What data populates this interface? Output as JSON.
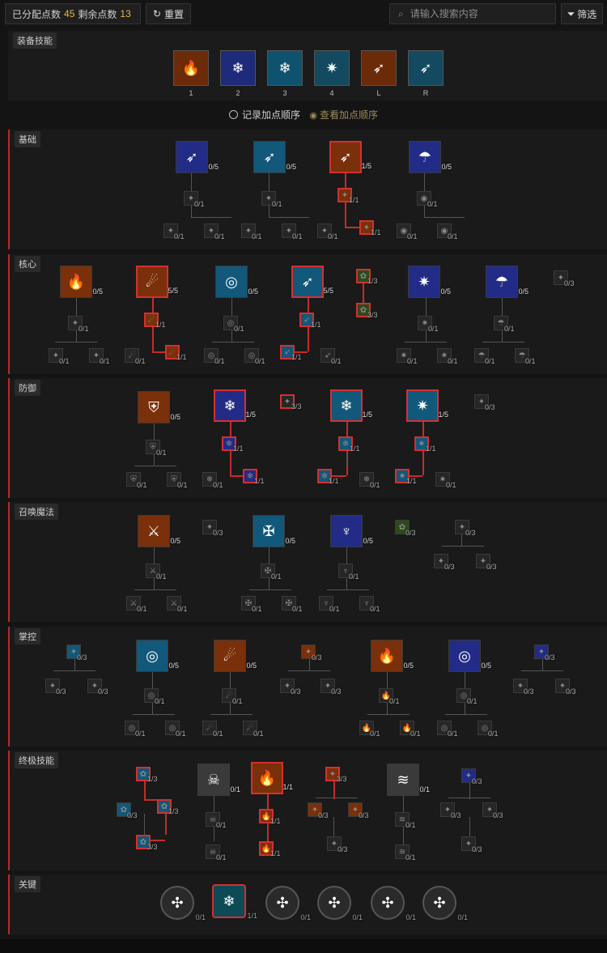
{
  "topbar": {
    "assigned_label": "已分配点数",
    "assigned_value": "45",
    "remaining_label": "剩余点数",
    "remaining_value": "13",
    "reset_label": "重置",
    "search_placeholder": "请输入搜索内容",
    "filter_label": "筛选"
  },
  "equipped": {
    "title": "装备技能",
    "slots": [
      {
        "key": "1",
        "icon": "fire-ring-icon",
        "color": "#c86a1a"
      },
      {
        "key": "2",
        "icon": "ice-tree-icon",
        "color": "#3e4fc8"
      },
      {
        "key": "3",
        "icon": "frost-shield-icon",
        "color": "#2e8fb8"
      },
      {
        "key": "4",
        "icon": "ice-burst-icon",
        "color": "#2e7fa0"
      },
      {
        "key": "L",
        "icon": "fire-bolt-icon",
        "color": "#c86a1a"
      },
      {
        "key": "R",
        "icon": "ice-shards-icon",
        "color": "#2e7fa0"
      }
    ]
  },
  "record": {
    "record_label": "记录加点顺序",
    "view_label": "查看加点顺序"
  },
  "sections": [
    {
      "title": "基础",
      "nodes": [
        {
          "cnt": "0/5"
        },
        {
          "cnt": "0/5"
        },
        {
          "cnt": "1/5"
        },
        {
          "cnt": "0/5"
        },
        {
          "cnt": "0/1"
        },
        {
          "cnt": "0/1"
        },
        {
          "cnt": "1/1"
        },
        {
          "cnt": "0/1"
        },
        {
          "cnt": "0/1"
        },
        {
          "cnt": "0/1"
        },
        {
          "cnt": "0/1"
        },
        {
          "cnt": "0/1"
        },
        {
          "cnt": "0/1"
        },
        {
          "cnt": "1/1"
        },
        {
          "cnt": "0/1"
        },
        {
          "cnt": "0/1"
        }
      ]
    },
    {
      "title": "核心",
      "nodes": [
        {
          "cnt": "0/5"
        },
        {
          "cnt": "5/5"
        },
        {
          "cnt": "0/5"
        },
        {
          "cnt": "5/5"
        },
        {
          "cnt": "1/3"
        },
        {
          "cnt": "0/5"
        },
        {
          "cnt": "0/5"
        },
        {
          "cnt": "0/3"
        },
        {
          "cnt": "0/1"
        },
        {
          "cnt": "1/1"
        },
        {
          "cnt": "0/1"
        },
        {
          "cnt": "1/1"
        },
        {
          "cnt": "3/3"
        },
        {
          "cnt": "0/1"
        },
        {
          "cnt": "0/1"
        },
        {
          "cnt": "0/1"
        },
        {
          "cnt": "0/1"
        },
        {
          "cnt": "0/1"
        },
        {
          "cnt": "1/1"
        },
        {
          "cnt": "0/1"
        },
        {
          "cnt": "0/1"
        },
        {
          "cnt": "1/1"
        },
        {
          "cnt": "0/1"
        },
        {
          "cnt": "0/1"
        },
        {
          "cnt": "0/1"
        },
        {
          "cnt": "0/1"
        },
        {
          "cnt": "0/1"
        }
      ]
    },
    {
      "title": "防御",
      "nodes": [
        {
          "cnt": "0/5"
        },
        {
          "cnt": "1/5"
        },
        {
          "cnt": "3/3"
        },
        {
          "cnt": "1/5"
        },
        {
          "cnt": "1/5"
        },
        {
          "cnt": "0/3"
        },
        {
          "cnt": "0/1"
        },
        {
          "cnt": "1/1"
        },
        {
          "cnt": "1/1"
        },
        {
          "cnt": "1/1"
        },
        {
          "cnt": "0/1"
        },
        {
          "cnt": "0/1"
        },
        {
          "cnt": "0/1"
        },
        {
          "cnt": "1/1"
        },
        {
          "cnt": "1/1"
        },
        {
          "cnt": "0/1"
        },
        {
          "cnt": "1/1"
        },
        {
          "cnt": "0/1"
        }
      ]
    },
    {
      "title": "召唤魔法",
      "nodes": [
        {
          "cnt": "0/5"
        },
        {
          "cnt": "0/3"
        },
        {
          "cnt": "0/5"
        },
        {
          "cnt": "0/5"
        },
        {
          "cnt": "0/3"
        },
        {
          "cnt": "0/3"
        },
        {
          "cnt": "0/1"
        },
        {
          "cnt": "0/1"
        },
        {
          "cnt": "0/1"
        },
        {
          "cnt": "0/3"
        },
        {
          "cnt": "0/3"
        },
        {
          "cnt": "0/1"
        },
        {
          "cnt": "0/1"
        },
        {
          "cnt": "0/1"
        },
        {
          "cnt": "0/1"
        },
        {
          "cnt": "0/1"
        },
        {
          "cnt": "0/1"
        }
      ]
    },
    {
      "title": "掌控",
      "nodes": [
        {
          "cnt": "0/3"
        },
        {
          "cnt": "0/5"
        },
        {
          "cnt": "0/5"
        },
        {
          "cnt": "0/3"
        },
        {
          "cnt": "0/5"
        },
        {
          "cnt": "0/5"
        },
        {
          "cnt": "0/3"
        },
        {
          "cnt": "0/3"
        },
        {
          "cnt": "0/3"
        },
        {
          "cnt": "0/1"
        },
        {
          "cnt": "0/1"
        },
        {
          "cnt": "0/3"
        },
        {
          "cnt": "0/3"
        },
        {
          "cnt": "0/1"
        },
        {
          "cnt": "0/1"
        },
        {
          "cnt": "0/3"
        },
        {
          "cnt": "0/3"
        },
        {
          "cnt": "0/1"
        },
        {
          "cnt": "0/1"
        },
        {
          "cnt": "0/1"
        },
        {
          "cnt": "0/1"
        },
        {
          "cnt": "0/1"
        },
        {
          "cnt": "0/1"
        },
        {
          "cnt": "0/1"
        },
        {
          "cnt": "0/1"
        }
      ]
    },
    {
      "title": "终极技能",
      "nodes": [
        {
          "cnt": "1/3"
        },
        {
          "cnt": "0/1"
        },
        {
          "cnt": "1/1"
        },
        {
          "cnt": "3/3"
        },
        {
          "cnt": "0/1"
        },
        {
          "cnt": "0/3"
        },
        {
          "cnt": "0/3"
        },
        {
          "cnt": "1/3"
        },
        {
          "cnt": "0/3"
        },
        {
          "cnt": "0/3"
        },
        {
          "cnt": "0/3"
        },
        {
          "cnt": "0/3"
        },
        {
          "cnt": "0/1"
        },
        {
          "cnt": "1/1"
        },
        {
          "cnt": "0/3"
        },
        {
          "cnt": "0/1"
        },
        {
          "cnt": "0/3"
        },
        {
          "cnt": "3/3"
        },
        {
          "cnt": "0/1"
        },
        {
          "cnt": "1/1"
        },
        {
          "cnt": "0/1"
        }
      ]
    },
    {
      "title": "关键",
      "nodes": [
        {
          "cnt": "0/1"
        },
        {
          "cnt": "1/1"
        },
        {
          "cnt": "0/1"
        },
        {
          "cnt": "0/1"
        },
        {
          "cnt": "0/1"
        },
        {
          "cnt": "0/1"
        }
      ]
    }
  ]
}
